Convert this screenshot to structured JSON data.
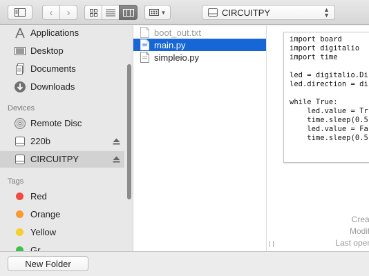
{
  "toolbar": {
    "path_label": "CIRCUITPY"
  },
  "sidebar": {
    "favorites": [
      {
        "label": "Applications",
        "icon": "applications-icon"
      },
      {
        "label": "Desktop",
        "icon": "desktop-icon"
      },
      {
        "label": "Documents",
        "icon": "documents-icon"
      },
      {
        "label": "Downloads",
        "icon": "downloads-icon"
      }
    ],
    "devices_heading": "Devices",
    "devices": [
      {
        "label": "Remote Disc",
        "icon": "remote-disc-icon"
      },
      {
        "label": "220b",
        "icon": "drive-icon"
      },
      {
        "label": "CIRCUITPY",
        "icon": "drive-icon",
        "selected": true
      }
    ],
    "tags_heading": "Tags",
    "tags": [
      {
        "label": "Red",
        "color": "#f04b3e"
      },
      {
        "label": "Orange",
        "color": "#f79a31"
      },
      {
        "label": "Yellow",
        "color": "#f5cf2a"
      },
      {
        "label": "Gr",
        "color": "#3cc24a"
      }
    ]
  },
  "files": [
    {
      "name": "boot_out.txt",
      "state": "dim"
    },
    {
      "name": "main.py",
      "state": "selected"
    },
    {
      "name": "simpleio.py",
      "state": "normal"
    }
  ],
  "preview": {
    "code_lines": [
      "import board",
      "import digitalio",
      "import time",
      "",
      "led = digitalio.Di",
      "led.direction = di",
      "",
      "while True:",
      "    led.value = Tr",
      "    time.sleep(0.5",
      "    led.value = Fa",
      "    time.sleep(0.5"
    ],
    "meta_created": "Creat",
    "meta_modified": "Modifi",
    "meta_last_opened": "Last open"
  },
  "bottom": {
    "new_folder_label": "New Folder"
  },
  "colors": {
    "selection_blue": "#1766d6",
    "sidebar_bg": "#e8e8e8"
  }
}
